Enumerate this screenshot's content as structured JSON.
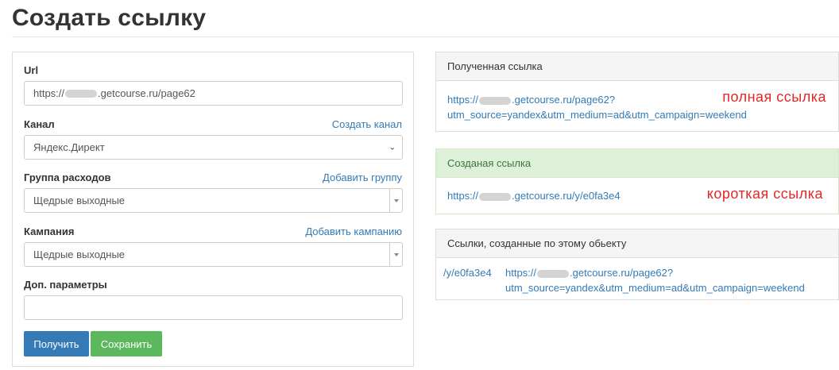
{
  "page": {
    "title": "Создать ссылку"
  },
  "form": {
    "url": {
      "label": "Url",
      "value_prefix": "https://",
      "value_suffix": ".getcourse.ru/page62"
    },
    "channel": {
      "label": "Канал",
      "link": "Создать канал",
      "selected": "Яндекс.Директ"
    },
    "expense_group": {
      "label": "Группа расходов",
      "link": "Добавить группу",
      "selected": "Щедрые выходные"
    },
    "campaign": {
      "label": "Кампания",
      "link": "Добавить кампанию",
      "selected": "Щедрые выходные"
    },
    "extra_params": {
      "label": "Доп. параметры",
      "value": ""
    },
    "get_button": "Получить",
    "save_button": "Сохранить"
  },
  "received_link": {
    "heading": "Полученная ссылка",
    "line1_prefix": "https://",
    "line1_suffix": ".getcourse.ru/page62?",
    "line2": "utm_source=yandex&utm_medium=ad&utm_campaign=weekend",
    "annotation": "полная ссылка"
  },
  "created_link": {
    "heading": "Созданая ссылка",
    "prefix": "https://",
    "suffix": ".getcourse.ru/y/e0fa3e4",
    "annotation": "короткая ссылка"
  },
  "object_links": {
    "heading": "Ссылки, созданные по этому обьекту",
    "rows": [
      {
        "short": "/y/e0fa3e4",
        "line1_prefix": "https://",
        "line1_suffix": ".getcourse.ru/page62?",
        "line2": "utm_source=yandex&utm_medium=ad&utm_campaign=weekend"
      }
    ]
  }
}
